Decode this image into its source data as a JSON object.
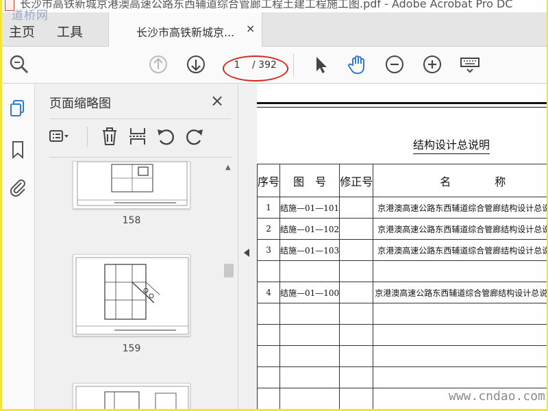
{
  "window": {
    "title": "长沙市高铁新城京港澳高速公路东西辅道综合管廊工程土建工程施工图.pdf - Adobe Acrobat Pro DC",
    "watermark_top": "道桥网"
  },
  "tabs": {
    "home": "主页",
    "tools": "工具",
    "document": "长沙市高铁新城京...",
    "close": "×"
  },
  "toolbar": {
    "current_page": "1",
    "total_pages": "/ 392",
    "icons": [
      "search-zoom-icon",
      "page-up-icon",
      "page-down-icon",
      "select-cursor-icon",
      "hand-tool-icon",
      "zoom-out-icon",
      "zoom-in-icon",
      "keyboard-icon"
    ]
  },
  "panel": {
    "title": "页面缩略图",
    "close": "×",
    "thumbnails": [
      {
        "page": "158"
      },
      {
        "page": "159"
      }
    ]
  },
  "document": {
    "heading": "结构设计总说明",
    "table_headers": [
      "序号",
      "图　号",
      "修正号",
      "名　　　　称"
    ],
    "rows": [
      {
        "no": "1",
        "drawing": "结施—01—101",
        "rev": "",
        "name": "京港澳高速公路东西辅道综合管廊结构设计总说明"
      },
      {
        "no": "2",
        "drawing": "结施—01—102",
        "rev": "",
        "name": "京港澳高速公路东西辅道综合管廊结构设计总说明"
      },
      {
        "no": "3",
        "drawing": "结施—01—103",
        "rev": "",
        "name": "京港澳高速公路东西辅道综合管廊结构设计总说明"
      },
      {
        "no": "",
        "drawing": "",
        "rev": "",
        "name": ""
      },
      {
        "no": "4",
        "drawing": "结施—01—100",
        "rev": "",
        "name": "京港澳高速公路东西辅道综合管廊结构设计总说明图纸"
      },
      {
        "no": "",
        "drawing": "",
        "rev": "",
        "name": ""
      },
      {
        "no": "",
        "drawing": "",
        "rev": "",
        "name": ""
      },
      {
        "no": "",
        "drawing": "",
        "rev": "",
        "name": ""
      },
      {
        "no": "",
        "drawing": "",
        "rev": "",
        "name": ""
      },
      {
        "no": "",
        "drawing": "",
        "rev": "",
        "name": ""
      }
    ]
  },
  "watermark_bottom": "www.cndao.com",
  "colors": {
    "border_highlight": "#f3e437",
    "annotation_red": "#d9231d",
    "accent_blue": "#2b7bd6"
  }
}
